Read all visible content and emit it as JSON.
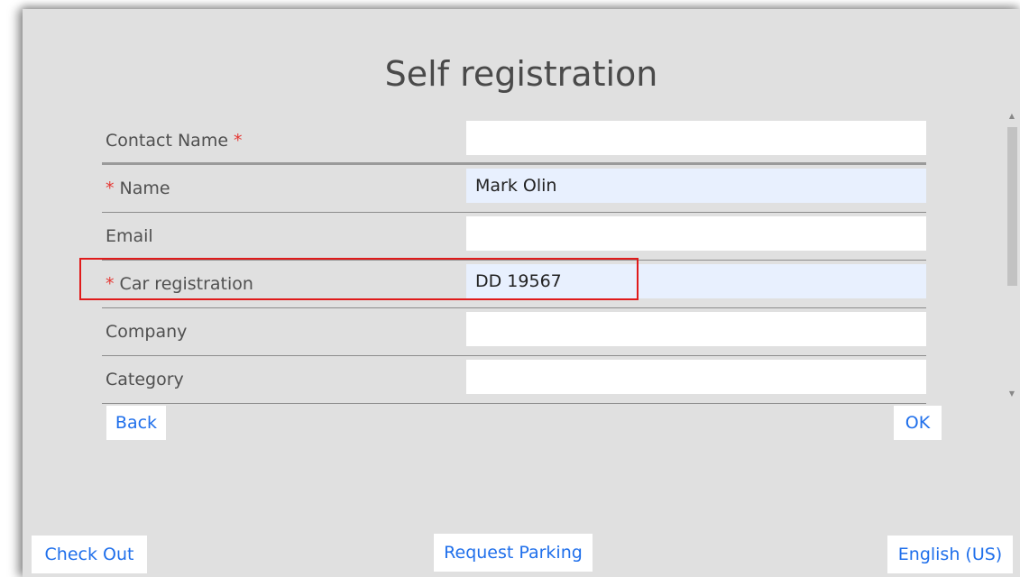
{
  "page": {
    "title": "Self registration"
  },
  "form": {
    "fields": [
      {
        "label": "Contact Name",
        "required_marker": " *",
        "required_prefix": "",
        "value": "",
        "filled": false
      },
      {
        "label": "Name",
        "required_prefix": "* ",
        "required_marker": "",
        "value": "Mark Olin",
        "filled": true
      },
      {
        "label": "Email",
        "required_prefix": "",
        "required_marker": "",
        "value": "",
        "filled": false
      },
      {
        "label": "Car registration",
        "required_prefix": "* ",
        "required_marker": "",
        "value": "DD 19567",
        "filled": true
      },
      {
        "label": "Company",
        "required_prefix": "",
        "required_marker": "",
        "value": "",
        "filled": false
      },
      {
        "label": "Category",
        "required_prefix": "",
        "required_marker": "",
        "value": "",
        "filled": false
      }
    ]
  },
  "buttons": {
    "back": "Back",
    "ok": "OK",
    "check_out": "Check Out",
    "request_parking": "Request Parking",
    "language": "English (US)"
  },
  "colors": {
    "background": "#e0e0e0",
    "link": "#1f6feb",
    "required": "#e53935",
    "filled_input": "#e8f0fe",
    "highlight": "#e01b1b"
  }
}
